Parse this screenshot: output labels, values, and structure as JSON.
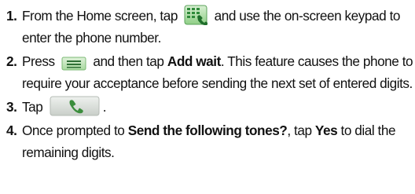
{
  "steps": [
    {
      "number": "1.",
      "t1": "From the Home screen, tap",
      "icon": "phone-app-icon",
      "t2": "and use the on-screen keypad to enter the phone number."
    },
    {
      "number": "2.",
      "t1": "Press",
      "icon": "menu-key-icon",
      "t2": "and then tap",
      "bold": "Add wait",
      "t3": ". This feature causes the phone to require your acceptance before sending the next set of entered digits."
    },
    {
      "number": "3.",
      "t1": "Tap",
      "icon": "call-button-icon",
      "t2": "."
    },
    {
      "number": "4.",
      "t1": "Once prompted to",
      "bold": "Send the following tones?",
      "t2": ", tap",
      "bold2": "Yes",
      "t3": "to dial the remaining digits."
    }
  ],
  "colors": {
    "text": "#111111",
    "icon_green_dark": "#2f8a3a",
    "icon_green_light": "#b9e3b0",
    "button_gray": "#d7dcd7"
  }
}
